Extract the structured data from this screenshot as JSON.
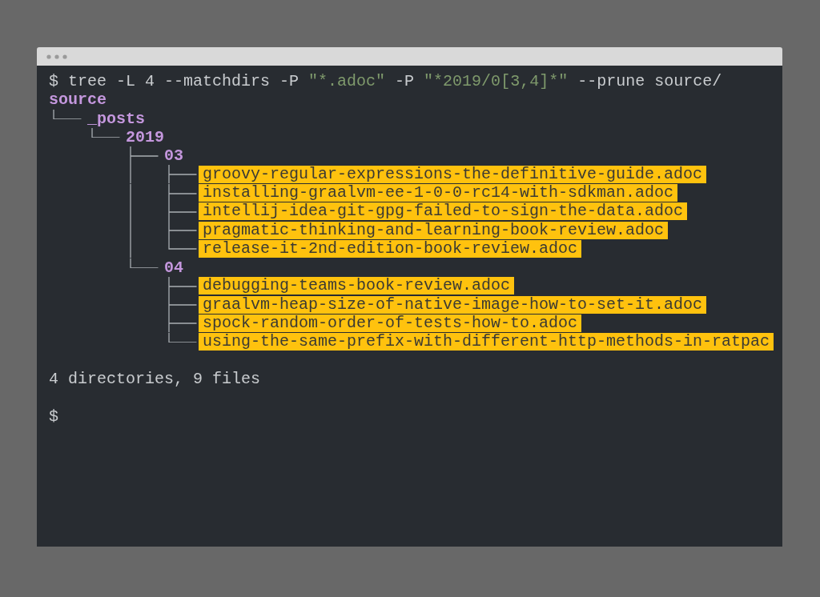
{
  "command": {
    "prompt": "$",
    "segments": [
      {
        "kind": "plain",
        "text": "tree -L 4 --matchdirs -P "
      },
      {
        "kind": "string",
        "text": "\"*.adoc\""
      },
      {
        "kind": "plain",
        "text": " -P "
      },
      {
        "kind": "string",
        "text": "\"*2019/0[3,4]*\""
      },
      {
        "kind": "plain",
        "text": " --prune source/"
      }
    ]
  },
  "tree": {
    "kind": "dir",
    "name": "source",
    "children": [
      {
        "kind": "dir",
        "name": "_posts",
        "children": [
          {
            "kind": "dir",
            "name": "2019",
            "children": [
              {
                "kind": "dir",
                "name": "03",
                "children": [
                  {
                    "kind": "file",
                    "name": "groovy-regular-expressions-the-definitive-guide.adoc"
                  },
                  {
                    "kind": "file",
                    "name": "installing-graalvm-ee-1-0-0-rc14-with-sdkman.adoc"
                  },
                  {
                    "kind": "file",
                    "name": "intellij-idea-git-gpg-failed-to-sign-the-data.adoc"
                  },
                  {
                    "kind": "file",
                    "name": "pragmatic-thinking-and-learning-book-review.adoc"
                  },
                  {
                    "kind": "file",
                    "name": "release-it-2nd-edition-book-review.adoc"
                  }
                ]
              },
              {
                "kind": "dir",
                "name": "04",
                "children": [
                  {
                    "kind": "file",
                    "name": "debugging-teams-book-review.adoc"
                  },
                  {
                    "kind": "file",
                    "name": "graalvm-heap-size-of-native-image-how-to-set-it.adoc"
                  },
                  {
                    "kind": "file",
                    "name": "spock-random-order-of-tests-how-to.adoc"
                  },
                  {
                    "kind": "file",
                    "name": "using-the-same-prefix-with-different-http-methods-in-ratpac"
                  }
                ]
              }
            ]
          }
        ]
      }
    ]
  },
  "summary": "4 directories, 9 files",
  "prompt": "$"
}
